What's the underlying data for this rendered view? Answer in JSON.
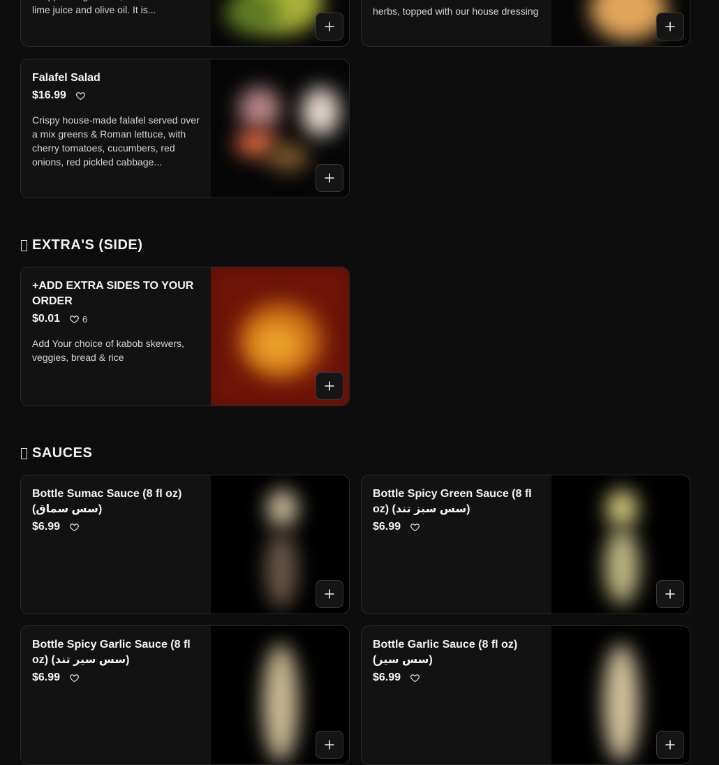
{
  "cards_top": [
    {
      "name": "",
      "price": "",
      "description": "chopped vegetables, all tossed with lime juice and olive oil. It is..."
    },
    {
      "name": "",
      "price": "",
      "description": "herbs, topped with our house dressing"
    }
  ],
  "falafel": {
    "name": "Falafel Salad",
    "price": "$16.99",
    "description": "Crispy house-made falafel served over a mix greens & Roman lettuce, with cherry tomatoes, cucumbers, red onions, red pickled cabbage..."
  },
  "sections": {
    "extras": "EXTRA'S (SIDE)",
    "sauces": "SAUCES"
  },
  "extras_item": {
    "name": "+ADD EXTRA SIDES TO YOUR ORDER",
    "price": "$0.01",
    "likes": "6",
    "description": "Add Your choice of kabob skewers, veggies, bread & rice"
  },
  "sauces": [
    {
      "name": "Bottle Sumac Sauce (8 fl oz) (سس سماق)",
      "price": "$6.99"
    },
    {
      "name": "Bottle Spicy Green Sauce (8 fl oz) (سس سبز تند)",
      "price": "$6.99"
    },
    {
      "name": "Bottle Spicy Garlic Sauce (8 fl oz) (سس سیر تند)",
      "price": "$6.99"
    },
    {
      "name": "Bottle Garlic Sauce (8 fl oz) (سس سیر)",
      "price": "$6.99"
    }
  ],
  "icons": {
    "heart": "heart-outline-icon",
    "add": "plus-icon",
    "section_glyph": "missing-glyph-icon"
  },
  "colors": {
    "background": "#0d0d0d",
    "card": "#121212",
    "border": "#2a2a2a",
    "text": "#f5f5f5"
  }
}
